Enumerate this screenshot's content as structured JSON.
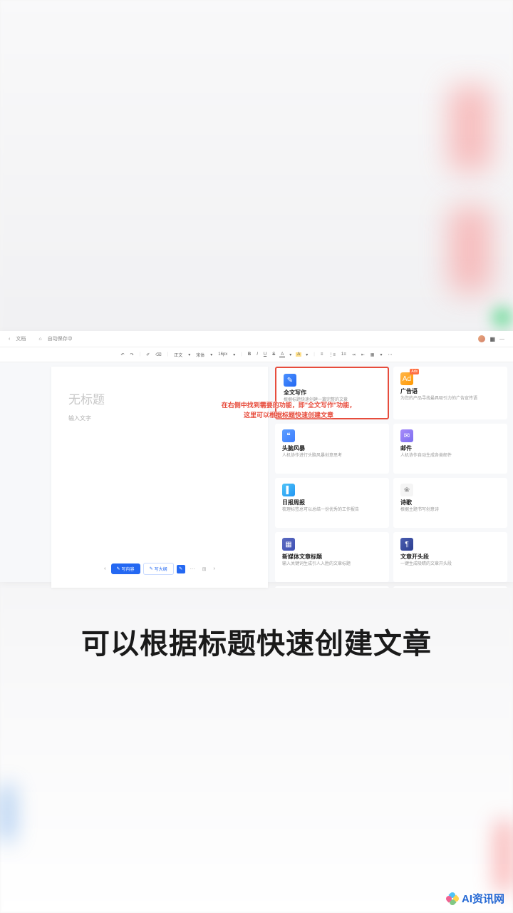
{
  "topbar": {
    "back_label": "文档",
    "autosave_label": "自动保存中"
  },
  "toolbar": {
    "undo": "↶",
    "redo": "↷",
    "format": "格式",
    "normal": "正文",
    "font": "宋体",
    "size": "16px",
    "bold": "B",
    "italic": "I",
    "underline": "U",
    "strike": "S",
    "color": "A",
    "highlight": "A"
  },
  "document": {
    "title_placeholder": "无标题",
    "body_placeholder": "输入文字",
    "btn_content": "写内容",
    "btn_outline": "写大纲"
  },
  "cards": [
    {
      "icon": "ic-blue",
      "glyph": "✎",
      "title": "全文写作",
      "desc": "根据标题快速创建一篇完整的文章",
      "highlight": true
    },
    {
      "icon": "ic-orange",
      "glyph": "Ad",
      "title": "广告语",
      "desc": "为您的产品寻找最具吸引力的广告宣传语"
    },
    {
      "icon": "ic-blue2",
      "glyph": "❝",
      "title": "头脑风暴",
      "desc": "人机协作进行头脑风暴创意思考"
    },
    {
      "icon": "ic-purple",
      "glyph": "✉",
      "title": "邮件",
      "desc": "人机协作自动生成各类邮件"
    },
    {
      "icon": "ic-cyan",
      "glyph": "▌",
      "title": "日报周报",
      "desc": "梳理标签总可以总结一份优秀的工作报告"
    },
    {
      "icon": "ic-grey",
      "glyph": "❀",
      "title": "诗歌",
      "desc": "根据主题书写创意诗"
    },
    {
      "icon": "ic-indigo",
      "glyph": "▦",
      "title": "新媒体文章标题",
      "desc": "输入关键词生成引人入胜的文章标题"
    },
    {
      "icon": "ic-navy",
      "glyph": "¶",
      "title": "文章开头段",
      "desc": "一键生成吸睛的文章开头段"
    }
  ],
  "annotation": {
    "line1": "在右侧中找到需要的功能，即\"全文写作\"功能，",
    "line2": "这里可以根据标题快速创建文章"
  },
  "caption": "可以根据标题快速创建文章",
  "watermark": "AI资讯网"
}
